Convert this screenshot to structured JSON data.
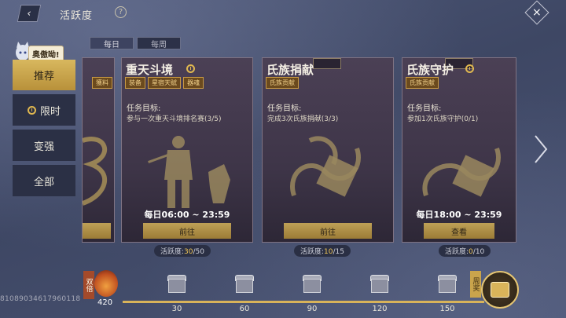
{
  "header": {
    "title": "活跃度",
    "help": "?",
    "back": "‹",
    "close": "×"
  },
  "period_tabs": [
    "每日",
    "每周"
  ],
  "nav": {
    "bubble": "奥傲呦!",
    "items": [
      {
        "label": "推荐",
        "active": true
      },
      {
        "label": "限时",
        "icon": "clock-icon"
      },
      {
        "label": "变强"
      },
      {
        "label": "全部"
      }
    ]
  },
  "partial_card": {
    "tag": "獲料",
    "button": ""
  },
  "cards": [
    {
      "title": "重天斗境",
      "tags": [
        "装备",
        "星宿天赋",
        "器魂"
      ],
      "goal_label": "任务目标:",
      "goal": "参与一次重天斗境排名赛(3/5)",
      "schedule": "每日06:00 ~ 23:59",
      "button": "前往",
      "points_label": "活跃度:",
      "points_done": "30",
      "points_total": "/50"
    },
    {
      "title": "氏族捐献",
      "tags": [
        "氏族贡献"
      ],
      "goal_label": "任务目标:",
      "goal": "完成3次氏族捐献(3/3)",
      "schedule": "",
      "button": "前往",
      "points_label": "活跃度:",
      "points_done": "10",
      "points_total": "/15"
    },
    {
      "title": "氏族守护",
      "tags": [
        "氏族贡献"
      ],
      "goal_label": "任务目标:",
      "goal": "参加1次氏族守护(0/1)",
      "schedule": "每日18:00 ~ 23:59",
      "button": "查看",
      "points_label": "活跃度:",
      "points_done": "0",
      "points_total": "/10"
    }
  ],
  "progress": {
    "double_label": "双倍",
    "current": "420",
    "uid": "81089034617960118",
    "milestones": [
      "30",
      "60",
      "90",
      "120",
      "150"
    ],
    "fill_fraction": 1.0,
    "weekly_label": "周奖"
  },
  "colors": {
    "accent": "#d8b35a",
    "bg": "#4e5878",
    "card": "#3e3548"
  }
}
